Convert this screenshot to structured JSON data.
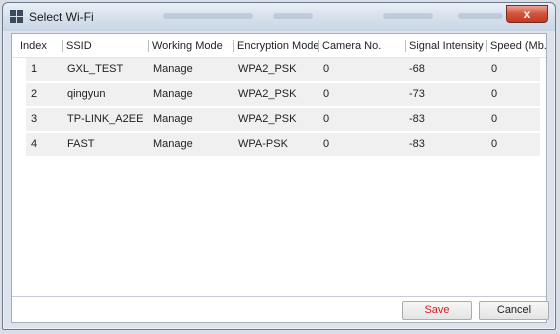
{
  "window": {
    "title": "Select Wi-Fi",
    "close_label": "x"
  },
  "table": {
    "columns": [
      "Index",
      "SSID",
      "Working Mode",
      "Encryption Mode",
      "Camera No.",
      "Signal Intensity",
      "Speed (Mb..."
    ],
    "rows": [
      [
        "1",
        "GXL_TEST",
        "Manage",
        "WPA2_PSK",
        "0",
        "-68",
        "0"
      ],
      [
        "2",
        "qingyun",
        "Manage",
        "WPA2_PSK",
        "0",
        "-73",
        "0"
      ],
      [
        "3",
        "TP-LINK_A2EE",
        "Manage",
        "WPA2_PSK",
        "0",
        "-83",
        "0"
      ],
      [
        "4",
        "FAST",
        "Manage",
        "WPA-PSK",
        "0",
        "-83",
        "0"
      ]
    ]
  },
  "buttons": {
    "save": "Save",
    "cancel": "Cancel"
  }
}
